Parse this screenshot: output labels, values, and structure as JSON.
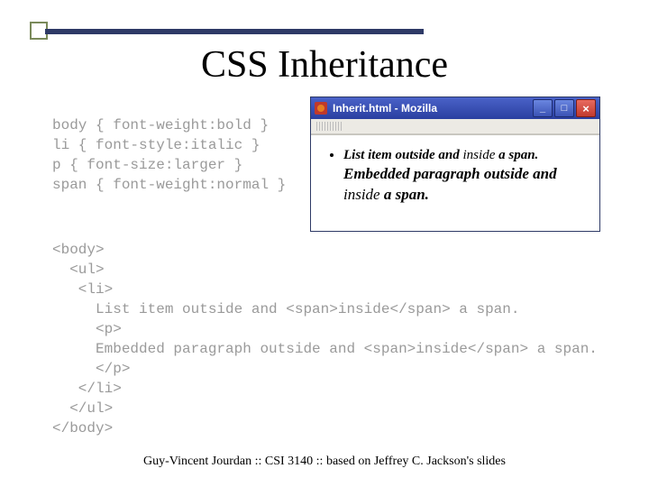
{
  "title": "CSS Inheritance",
  "css_code": "body { font-weight:bold }\nli { font-style:italic }\np { font-size:larger }\nspan { font-weight:normal }",
  "html_code": "<body>\n  <ul>\n   <li>\n     List item outside and <span>inside</span> a span.\n     <p>\n     Embedded paragraph outside and <span>inside</span> a span.\n     </p>\n   </li>\n  </ul>\n</body>",
  "window": {
    "title": "Inherit.html - Mozilla",
    "li_before": "List item outside and ",
    "li_span": "inside",
    "li_after": " a span.",
    "p_before": "Embedded paragraph outside and ",
    "p_span": "inside",
    "p_after": " a span.",
    "min_label": "_",
    "max_label": "□",
    "close_label": "×"
  },
  "footer": "Guy-Vincent Jourdan :: CSI 3140 :: based on Jeffrey C. Jackson's slides"
}
